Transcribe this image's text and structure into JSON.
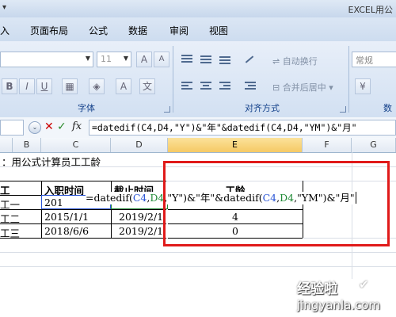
{
  "window": {
    "title": "EXCEL用公"
  },
  "menu": {
    "tabs": [
      "入",
      "页面布局",
      "公式",
      "数据",
      "审阅",
      "视图"
    ]
  },
  "ribbon": {
    "font_size": "11",
    "font_group_label": "字体",
    "wrap_text": "自动换行",
    "merge_center": "合并后居中",
    "alignment_group_label": "对齐方式",
    "number_format": "常规",
    "number_group_label": "数"
  },
  "formula_bar": {
    "value": "=datedif(C4,D4,\"Y\")&\"年\"&datedif(C4,D4,\"YM\")&\"月\""
  },
  "columns": [
    "B",
    "C",
    "D",
    "E",
    "F",
    "G"
  ],
  "sheet": {
    "title": "：用公式计算员工工龄",
    "headers": {
      "name": "工",
      "hire_date": "入职时间",
      "end_date": "截止时间",
      "seniority": "工龄"
    },
    "rows": [
      {
        "name": "工一",
        "hire_date": "201",
        "end_date": "",
        "seniority": ""
      },
      {
        "name": "工二",
        "hire_date": "2015/1/1",
        "end_date": "2019/2/1",
        "seniority": "4"
      },
      {
        "name": "工三",
        "hire_date": "2018/6/6",
        "end_date": "2019/2/1",
        "seniority": "0"
      }
    ],
    "edit_formula": {
      "p1": "=datedif(",
      "ref1": "C4",
      "p2": ",",
      "ref2": "D4",
      "p3": ",\"Y\")&\"年\"&datedif(",
      "ref3": "C4",
      "p4": ",",
      "ref4": "D4",
      "p5": ",\"YM\")&\"月\""
    }
  },
  "watermark": {
    "line1": "经验啦",
    "line2": "jingyanla.com"
  },
  "colors": {
    "highlight_box": "#e01a1a",
    "ref_c": "#2a55d6",
    "ref_d": "#1f8a35"
  }
}
